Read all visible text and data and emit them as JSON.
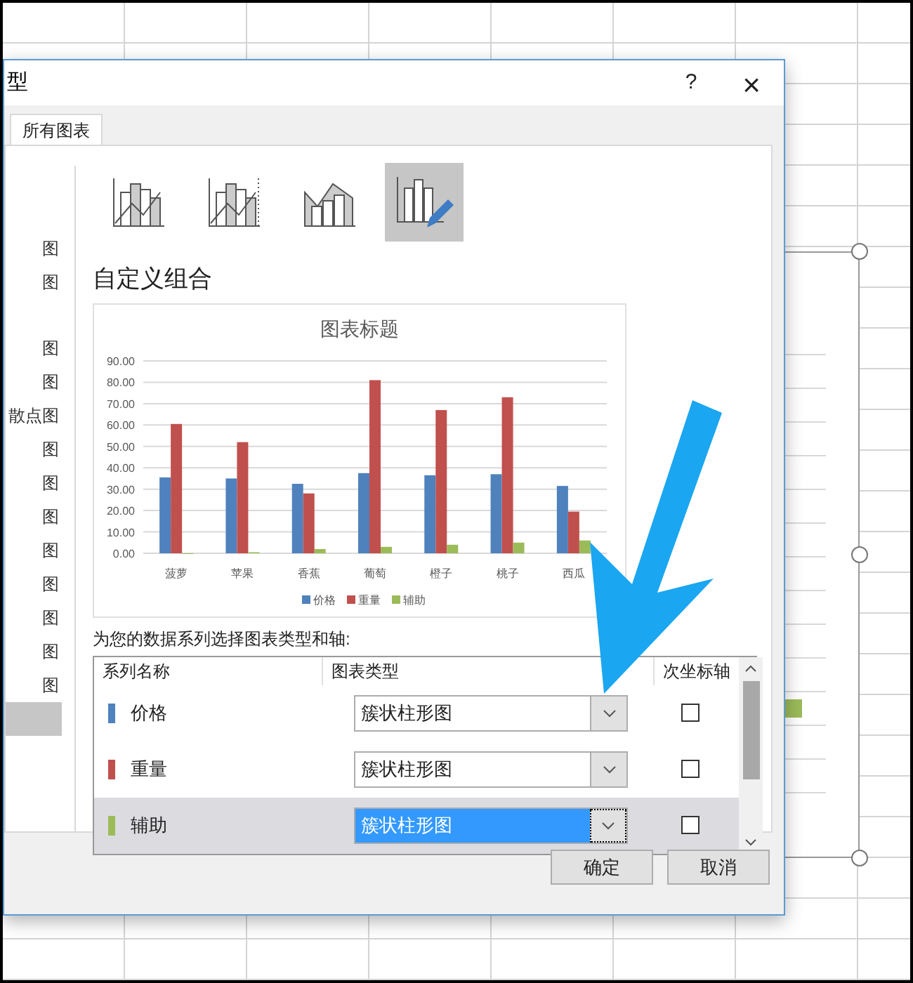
{
  "dialog": {
    "title": "型",
    "help": "?",
    "close": "×"
  },
  "tabs": [
    {
      "label": "所有图表",
      "selected": true
    }
  ],
  "chart_type_groups": [
    {
      "items": [
        {
          "label": "图",
          "selected": false
        },
        {
          "label": "图",
          "selected": false
        }
      ]
    },
    {
      "items": [
        {
          "label": "图",
          "selected": false
        },
        {
          "label": "图",
          "selected": false
        },
        {
          "label": "散点图",
          "selected": false
        },
        {
          "label": "图",
          "selected": false
        },
        {
          "label": "图",
          "selected": false
        },
        {
          "label": "图",
          "selected": false
        },
        {
          "label": "图",
          "selected": false
        },
        {
          "label": "图",
          "selected": false
        },
        {
          "label": "图",
          "selected": false
        },
        {
          "label": "图",
          "selected": false
        },
        {
          "label": "图",
          "selected": false
        },
        {
          "selected": true
        }
      ]
    }
  ],
  "subtypes": [
    {
      "kind": "cluster-line",
      "selected": false
    },
    {
      "kind": "cluster-line-secondary",
      "selected": false
    },
    {
      "kind": "area-cluster",
      "selected": false
    },
    {
      "kind": "custom",
      "selected": true
    }
  ],
  "heading": "自定义组合",
  "preview": {
    "chart_data": {
      "type": "bar",
      "title": "图表标题",
      "categories": [
        "菠萝",
        "苹果",
        "香蕉",
        "葡萄",
        "橙子",
        "桃子",
        "西瓜"
      ],
      "series": [
        {
          "name": "价格",
          "color": "#4f81bd",
          "values": [
            35.5,
            35,
            32.5,
            37.5,
            36.5,
            37,
            31.5
          ]
        },
        {
          "name": "重量",
          "color": "#c0504d",
          "values": [
            60.5,
            52,
            28,
            81,
            67,
            73,
            19.5
          ]
        },
        {
          "name": "辅助",
          "color": "#9bbb59",
          "values": [
            0,
            0.5,
            2,
            3,
            4,
            5,
            6
          ]
        }
      ],
      "ylim": [
        0,
        90
      ],
      "grid": true,
      "legend": "bottom",
      "yticks": [
        {
          "value": 0,
          "label": "0.00"
        },
        {
          "value": 10,
          "label": "10.00"
        },
        {
          "value": 20,
          "label": "20.00"
        },
        {
          "value": 30,
          "label": "30.00"
        },
        {
          "value": 40,
          "label": "40.00"
        },
        {
          "value": 50,
          "label": "50.00"
        },
        {
          "value": 60,
          "label": "60.00"
        },
        {
          "value": 70,
          "label": "70.00"
        },
        {
          "value": 80,
          "label": "80.00"
        },
        {
          "value": 90,
          "label": "90.00"
        }
      ]
    }
  },
  "series_prompt": "为您的数据系列选择图表类型和轴:",
  "series_table": {
    "columns": [
      "系列名称",
      "图表类型",
      "次坐标轴"
    ],
    "rows": [
      {
        "name": "价格",
        "color": "#4f81bd",
        "chart_type": "簇状柱形图",
        "secondary_axis": false,
        "selected": false
      },
      {
        "name": "重量",
        "color": "#c0504d",
        "chart_type": "簇状柱形图",
        "secondary_axis": false,
        "selected": false
      },
      {
        "name": "辅助",
        "color": "#9bbb59",
        "chart_type": "簇状柱形图",
        "secondary_axis": false,
        "selected": true
      }
    ]
  },
  "buttons": [
    "确定",
    "取消"
  ]
}
